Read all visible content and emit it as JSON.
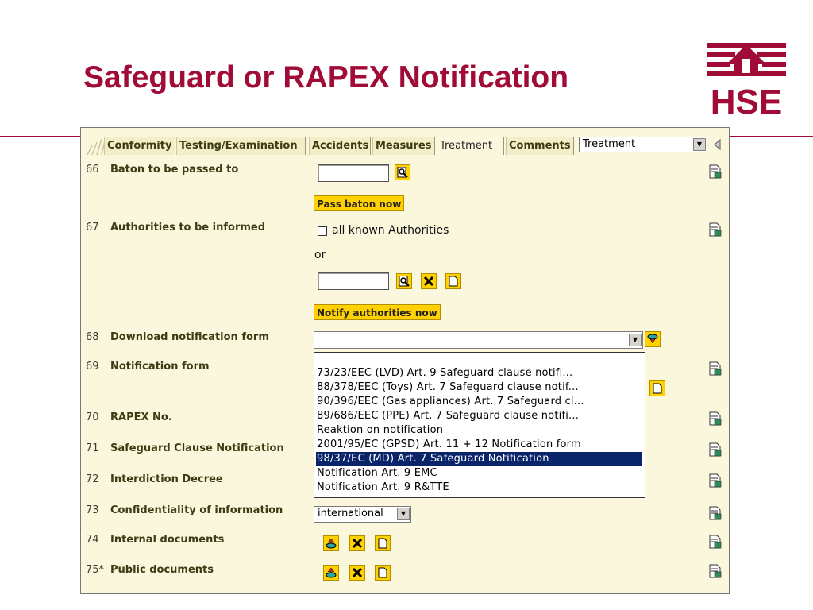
{
  "slide": {
    "title": "Safeguard or RAPEX Notification",
    "logo_text": "HSE"
  },
  "colors": {
    "brand": "#a00b37",
    "panel_bg": "#faf7dd",
    "button_yellow": "#ffd100",
    "selection": "#0a246a"
  },
  "tabs": [
    {
      "label": "Conformity",
      "active": false
    },
    {
      "label": "Testing/Examination",
      "active": false
    },
    {
      "label": "Accidents",
      "active": false
    },
    {
      "label": "Measures",
      "active": false
    },
    {
      "label": "Treatment",
      "active": true
    },
    {
      "label": "Comments",
      "active": false
    }
  ],
  "tab_select": {
    "value": "Treatment"
  },
  "rows": [
    {
      "num": "66",
      "label": "Baton to be passed to"
    },
    {
      "num": "67",
      "label": "Authorities to be informed"
    },
    {
      "num": "68",
      "label": "Download notification form"
    },
    {
      "num": "69",
      "label": "Notification form"
    },
    {
      "num": "70",
      "label": "RAPEX No."
    },
    {
      "num": "71",
      "label": "Safeguard Clause Notification"
    },
    {
      "num": "72",
      "label": "Interdiction Decree"
    },
    {
      "num": "73",
      "label": "Confidentiality of information"
    },
    {
      "num": "74",
      "label": "Internal documents"
    },
    {
      "num": "75*",
      "label": "Public documents"
    }
  ],
  "baton": {
    "button": "Pass baton now"
  },
  "authorities": {
    "checkbox_label": "all known Authorities",
    "or_text": "or",
    "button": "Notify authorities now"
  },
  "download_form": {
    "value": "",
    "options": [
      "73/23/EEC (LVD) Art. 9 Safeguard clause notifi...",
      "88/378/EEC (Toys) Art. 7 Safeguard clause notif...",
      "90/396/EEC (Gas appliances) Art. 7 Safeguard cl...",
      "89/686/EEC (PPE) Art. 7 Safeguard clause notifi...",
      "Reaktion on notification",
      "2001/95/EC (GPSD) Art. 11 + 12 Notification form",
      "98/37/EC (MD) Art. 7 Safeguard Notification",
      "Notification Art. 9 EMC",
      "Notification Art. 9 R&TTE"
    ],
    "selected_index": 6
  },
  "confidentiality": {
    "value": "international"
  },
  "icons": {
    "side": "edit-page-icon",
    "search": "magnifier-icon",
    "delete": "delete-x-icon",
    "new": "new-document-icon",
    "upload": "upload-icon",
    "download": "download-icon",
    "collapse": "collapse-left-arrow-icon",
    "dropdown": "chevron-down-icon"
  }
}
